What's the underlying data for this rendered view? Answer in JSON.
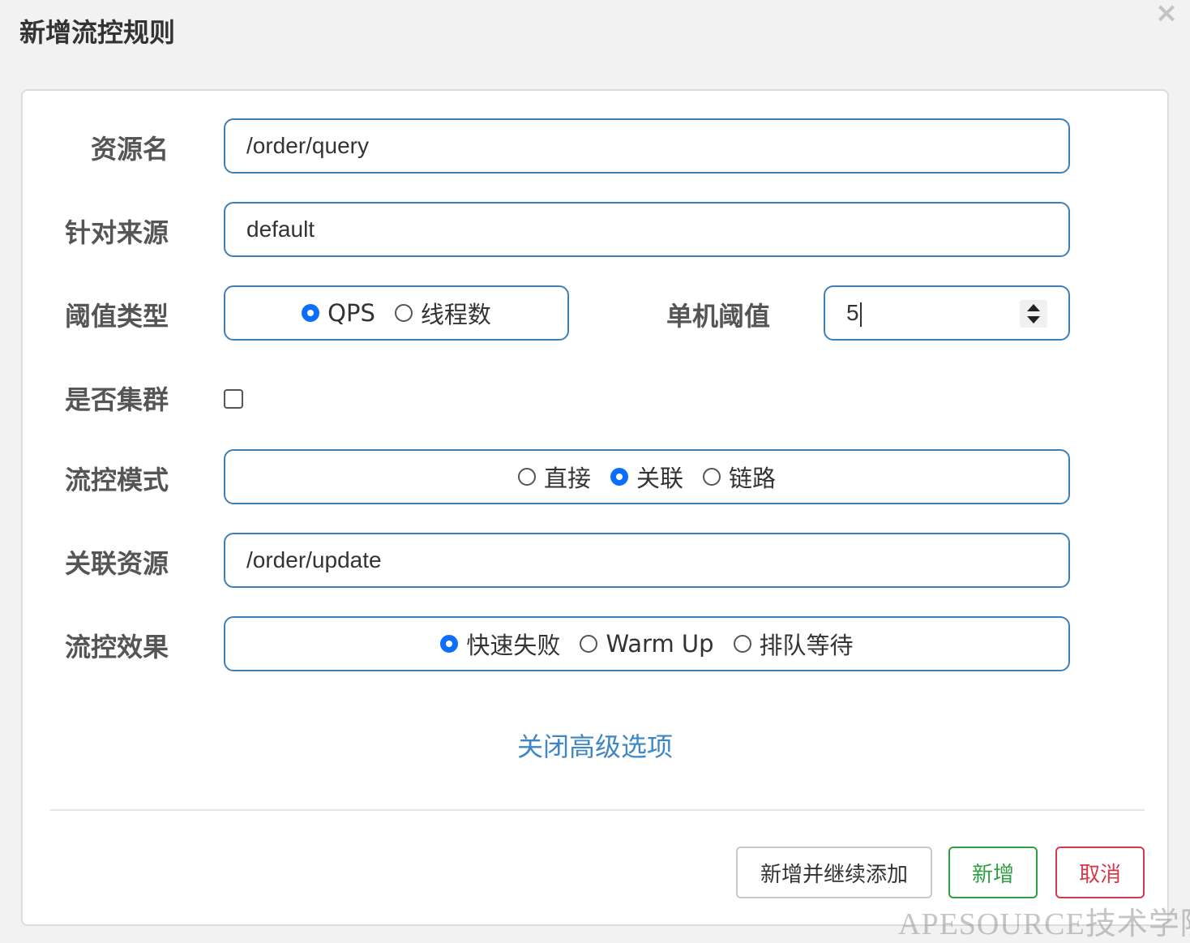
{
  "dialog": {
    "title": "新增流控规则",
    "close_icon": "×"
  },
  "form": {
    "resource": {
      "label": "资源名",
      "value": "/order/query"
    },
    "limit_app": {
      "label": "针对来源",
      "value": "default"
    },
    "grade": {
      "label": "阈值类型",
      "options": [
        {
          "label": "QPS",
          "checked": true
        },
        {
          "label": "线程数",
          "checked": false
        }
      ]
    },
    "count": {
      "label": "单机阈值",
      "value": "5"
    },
    "cluster": {
      "label": "是否集群",
      "checked": false
    },
    "strategy": {
      "label": "流控模式",
      "options": [
        {
          "label": "直接",
          "checked": false
        },
        {
          "label": "关联",
          "checked": true
        },
        {
          "label": "链路",
          "checked": false
        }
      ]
    },
    "ref_resource": {
      "label": "关联资源",
      "value": "/order/update"
    },
    "control_behavior": {
      "label": "流控效果",
      "options": [
        {
          "label": "快速失败",
          "checked": true
        },
        {
          "label": "Warm Up",
          "checked": false
        },
        {
          "label": "排队等待",
          "checked": false
        }
      ]
    },
    "advanced_link": "关闭高级选项"
  },
  "buttons": {
    "add_continue": "新增并继续添加",
    "add": "新增",
    "cancel": "取消"
  },
  "colors": {
    "input_border": "#3f7fb8",
    "radio_checked": "#0d6efd",
    "link": "#3f87c4",
    "success": "#2e9f45",
    "danger": "#d33a4a"
  },
  "watermark": "APESOURCE技术学院"
}
